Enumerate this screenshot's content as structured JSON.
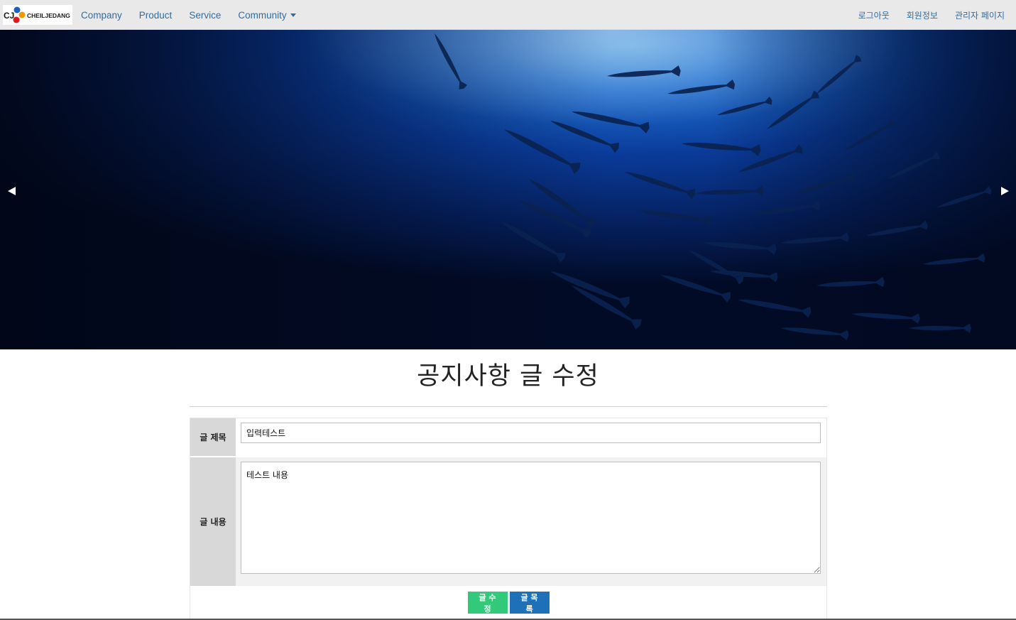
{
  "navbar": {
    "brand": {
      "name": "CJ CHEILJEDANG",
      "colors": {
        "red": "#e3161b",
        "orange": "#f39800",
        "blue": "#1f5fb5"
      }
    },
    "left_links": [
      {
        "label": "Company"
      },
      {
        "label": "Product"
      },
      {
        "label": "Service"
      },
      {
        "label": "Community",
        "has_dropdown": true
      }
    ],
    "right_links": [
      {
        "label": "로그아웃"
      },
      {
        "label": "회원정보"
      },
      {
        "label": "관리자 페이지"
      }
    ]
  },
  "carousel": {
    "image": "underwater-school-of-barracuda",
    "prev_icon": "triangle-left-icon",
    "next_icon": "triangle-right-icon"
  },
  "page": {
    "title": "공지사항 글 수정"
  },
  "form": {
    "title_label": "글 제목",
    "title_value": "입력테스트",
    "content_label": "글 내용",
    "content_value": "테스트 내용",
    "submit_label": "글 수정",
    "list_label": "글 목록"
  },
  "colors": {
    "nav_link": "#2e6da4",
    "edit_button": "#32c97a",
    "list_button": "#1e70b8"
  }
}
